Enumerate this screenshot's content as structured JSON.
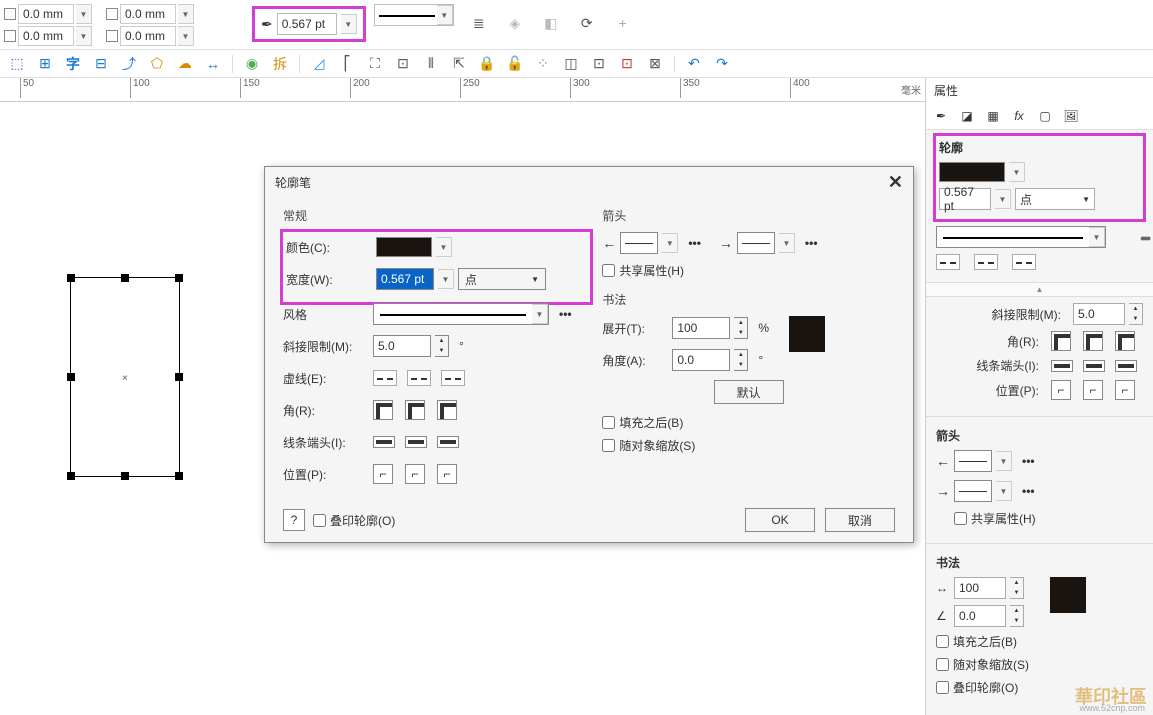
{
  "propBar": {
    "x": "0.0 mm",
    "y": "0.0 mm",
    "w": "0.0 mm",
    "h": "0.0 mm",
    "outlineWidth": "0.567 pt"
  },
  "ruler": {
    "ticks": [
      "50",
      "100",
      "150",
      "200",
      "250",
      "300",
      "350",
      "400"
    ],
    "unit": "毫米"
  },
  "dlg": {
    "title": "轮廓笔",
    "general": {
      "header": "常规",
      "color": "颜色(C):",
      "width": "宽度(W):",
      "widthVal": "0.567 pt",
      "unit": "点",
      "style": "风格",
      "miter": "斜接限制(M):",
      "miterVal": "5.0",
      "miterUnit": "°",
      "dash": "虚线(E):",
      "corner": "角(R):",
      "cap": "线条端头(I):",
      "pos": "位置(P):"
    },
    "arrow": {
      "header": "箭头",
      "share": "共享属性(H)"
    },
    "callig": {
      "header": "书法",
      "spread": "展开(T):",
      "spreadVal": "100",
      "spreadUnit": "%",
      "angle": "角度(A):",
      "angleVal": "0.0",
      "angleUnit": "°",
      "default": "默认"
    },
    "opts": {
      "behind": "填充之后(B)",
      "scale": "随对象缩放(S)"
    },
    "help": "?",
    "overprint": "叠印轮廓(O)",
    "ok": "OK",
    "cancel": "取消"
  },
  "dock": {
    "title": "属性",
    "section": "轮廓",
    "width": "0.567 pt",
    "unit": "点",
    "miterLbl": "斜接限制(M):",
    "miterVal": "5.0",
    "cornerLbl": "角(R):",
    "capLbl": "线条端头(I):",
    "posLbl": "位置(P):",
    "arrowHd": "箭头",
    "share": "共享属性(H)",
    "calligHd": "书法",
    "spreadVal": "100",
    "angleVal": "0.0",
    "behind": "填充之后(B)",
    "scale": "随对象缩放(S)",
    "overprint": "叠印轮廓(O)"
  }
}
